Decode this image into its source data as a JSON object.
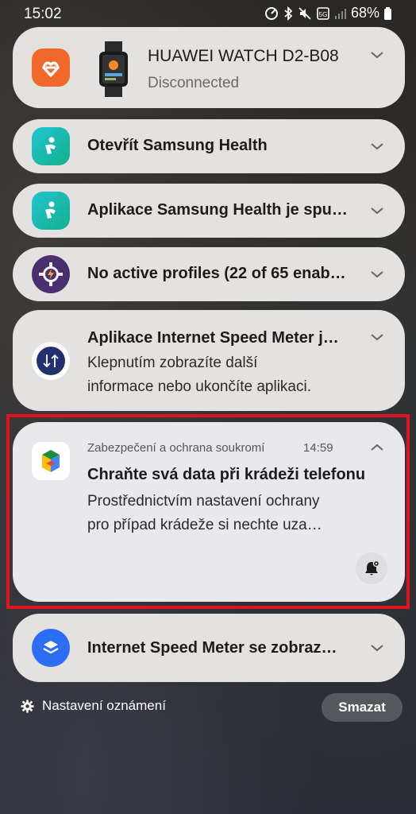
{
  "status_bar": {
    "time": "15:02",
    "battery": "68%"
  },
  "notifications": [
    {
      "title": "HUAWEI WATCH D2-B08",
      "subtitle": "Disconnected",
      "icon": "huawei-health-icon",
      "device_icon": "smartwatch-icon"
    },
    {
      "title": "Otevřít Samsung Health",
      "icon": "samsung-health-icon"
    },
    {
      "title": "Aplikace Samsung Health je spu…",
      "icon": "samsung-health-icon"
    },
    {
      "title": "No active profiles (22 of 65 enab…",
      "icon": "tasker-gear-icon"
    },
    {
      "title": "Aplikace Internet Speed Meter j…",
      "body_line1": "Klepnutím zobrazíte další",
      "body_line2": "informace nebo ukončíte aplikaci.",
      "icon": "speed-meter-icon"
    },
    {
      "app_name": "Zabezpečení a ochrana soukromí",
      "time": "14:59",
      "title": "Chraňte svá data při krádeži telefonu",
      "body_line1": "Prostřednictvím nastavení ochrany",
      "body_line2": "pro případ krádeže si nechte uza…",
      "icon": "google-play-services-icon",
      "action_icon": "notification-bell-icon"
    },
    {
      "title": "Internet Speed Meter se zobraz…",
      "icon": "layers-icon"
    }
  ],
  "footer": {
    "settings_label": "Nastavení oznámení",
    "clear_label": "Smazat"
  },
  "colors": {
    "card": "#e4e2e1",
    "highlight": "#e0141e",
    "huawei_orange": "#f2682a",
    "samsung_health_teal": "#1ab7a8",
    "tasker_purple": "#4a2f6e",
    "speed_meter_navy": "#23306e",
    "layers_blue": "#2c6ef2"
  }
}
